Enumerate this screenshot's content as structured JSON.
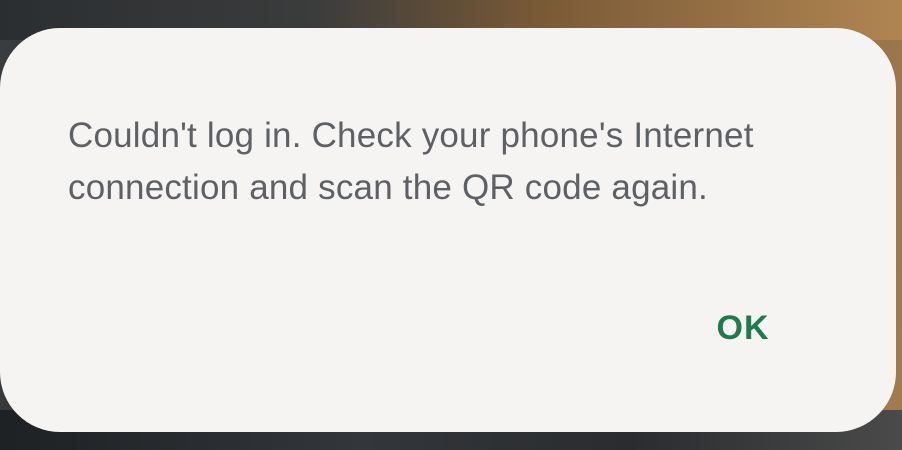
{
  "dialog": {
    "message": "Couldn't log in. Check your phone's Internet connection and scan the QR code again.",
    "ok_label": "OK"
  },
  "colors": {
    "dialog_background": "#f6f4f2",
    "message_text": "#5d6166",
    "button_text": "#1f7a4e"
  }
}
